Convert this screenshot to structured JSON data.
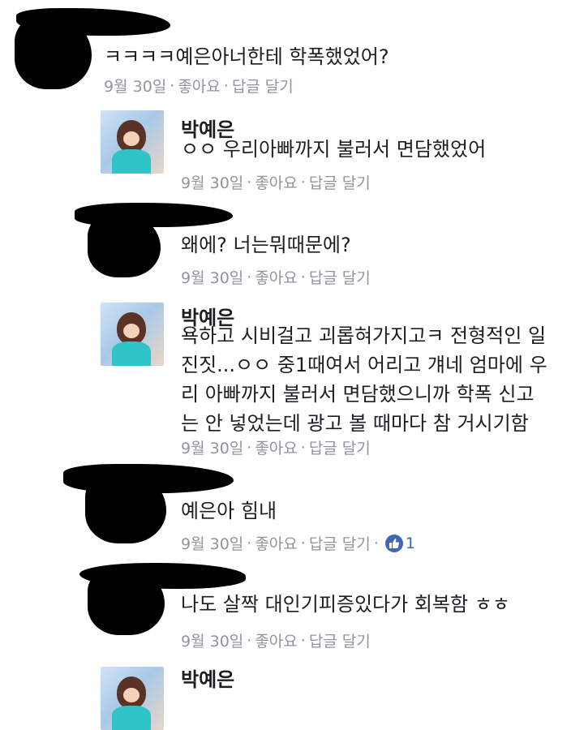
{
  "comments": [
    {
      "name": "",
      "lines": [
        "ㅋㅋㅋㅋ예은아너한테 학폭했었어?"
      ],
      "date": "9월 30일",
      "like": "좋아요",
      "reply": "답글 달기"
    },
    {
      "name": "박예은",
      "lines": [
        "ㅇㅇ 우리아빠까지 불러서 면담했었어"
      ],
      "date": "9월 30일",
      "like": "좋아요",
      "reply": "답글 달기"
    },
    {
      "name": "",
      "lines": [
        "왜에? 너는뭐때문에?"
      ],
      "date": "9월 30일",
      "like": "좋아요",
      "reply": "답글 달기"
    },
    {
      "name": "박예은",
      "lines": [
        "욕하고 시비걸고 괴롭혀가지고ㅋ 전형적인 일",
        "진짓...ㅇㅇ 중1때여서 어리고 걔네 엄마에 우",
        "리 아빠까지 불러서 면담했으니까 학폭 신고",
        "는 안 넣었는데 광고 볼 때마다 참 거시기함"
      ],
      "date": "9월 30일",
      "like": "좋아요",
      "reply": "답글 달기"
    },
    {
      "name": "",
      "lines": [
        "예은아 힘내"
      ],
      "date": "9월 30일",
      "like": "좋아요",
      "reply": "답글 달기",
      "like_count": "1"
    },
    {
      "name": "",
      "lines": [
        "나도 살짝 대인기피증있다가 회복함 ㅎㅎ"
      ],
      "date": "9월 30일",
      "like": "좋아요",
      "reply": "답글 달기"
    },
    {
      "name": "박예은",
      "lines": []
    }
  ],
  "separator": "·",
  "colors": {
    "meta": "#90949c",
    "like_blue": "#4267b2",
    "text": "#1c1e21"
  },
  "icons": {
    "like_badge": "thumbs-up-icon"
  }
}
